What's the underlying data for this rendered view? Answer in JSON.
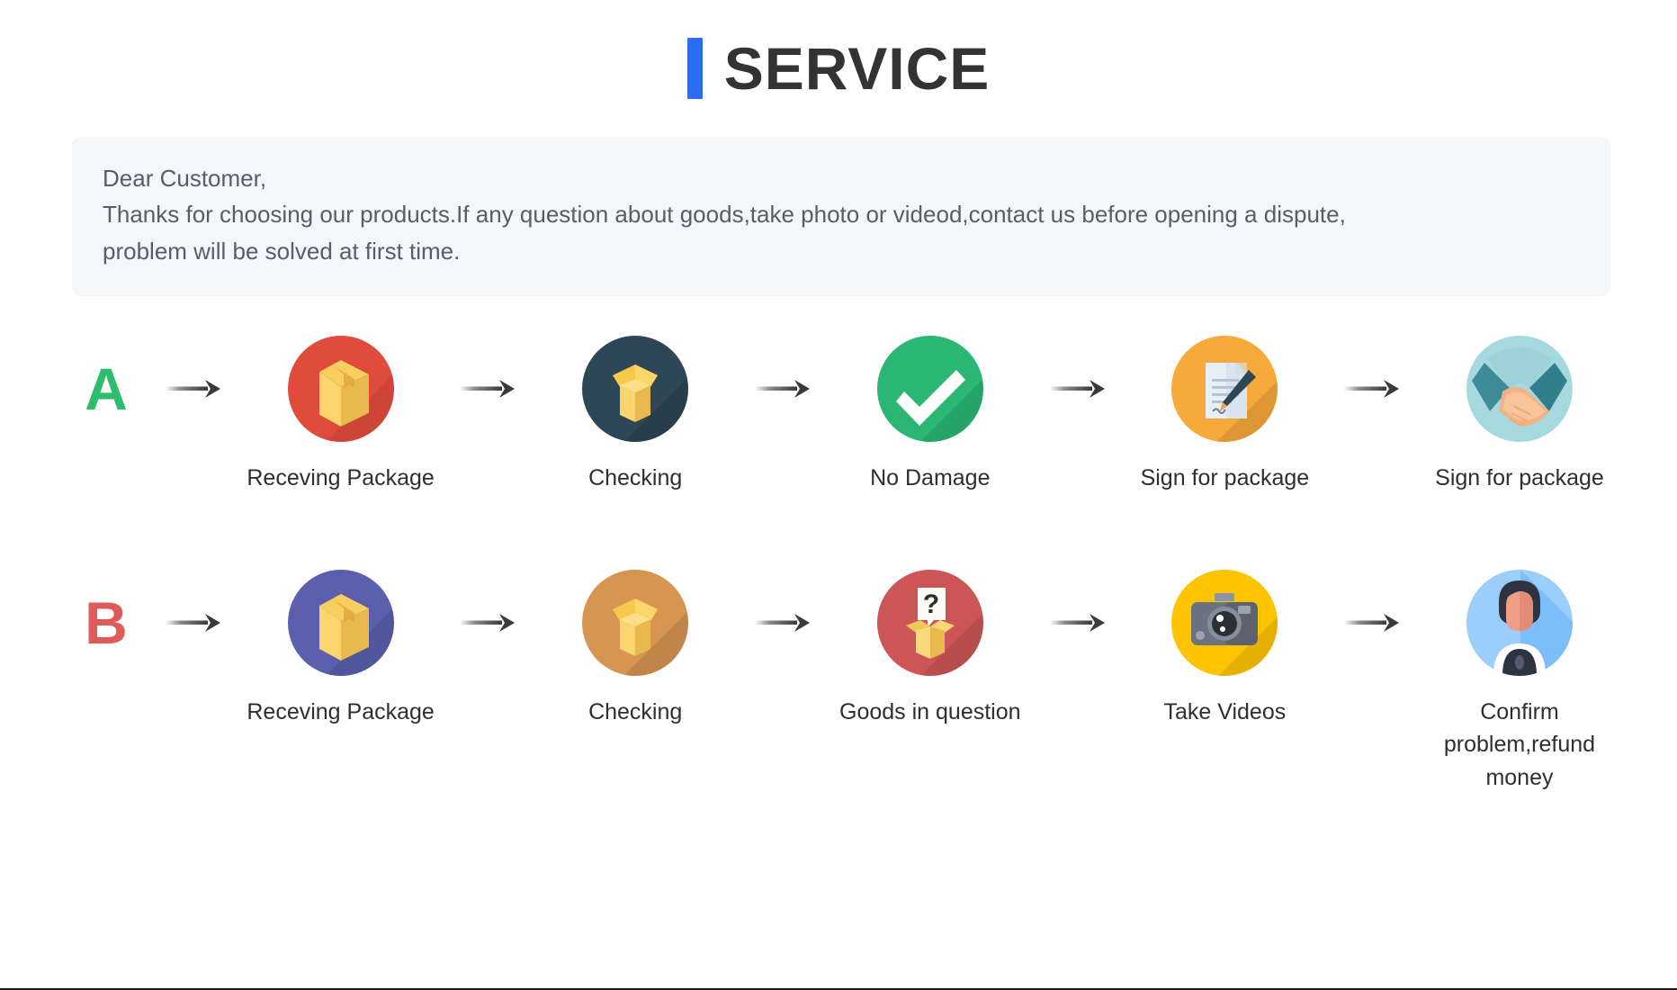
{
  "header": {
    "title": "SERVICE",
    "accent_color": "#2b6cf0"
  },
  "notice": {
    "line1": "Dear Customer,",
    "line2": "Thanks for choosing our products.If any question about goods,take photo or videod,contact us before opening a dispute,",
    "line3": "problem will be solved at first time.",
    "background_color": "#f4f6fa",
    "text_color": "#585e68"
  },
  "flows": [
    {
      "badge": "A",
      "badge_color": "#2ebd6e",
      "arrow": "arrow-right-icon",
      "steps": [
        {
          "label": "Receving Package",
          "icon": "package-box-icon",
          "circle_color": "#e04b3c"
        },
        {
          "label": "Checking",
          "icon": "open-box-icon",
          "circle_color": "#2e4756"
        },
        {
          "label": "No Damage",
          "icon": "check-mark-icon",
          "circle_color": "#2bb673"
        },
        {
          "label": "Sign for package",
          "icon": "document-pen-icon",
          "circle_color": "#f7a93b"
        },
        {
          "label": "Sign for package",
          "icon": "handshake-icon",
          "circle_color": "#a6d9de"
        }
      ]
    },
    {
      "badge": "B",
      "badge_color": "#e05a5a",
      "arrow": "arrow-right-icon",
      "steps": [
        {
          "label": "Receving Package",
          "icon": "package-box-icon",
          "circle_color": "#5b5fae"
        },
        {
          "label": "Checking",
          "icon": "open-box-icon",
          "circle_color": "#d79552"
        },
        {
          "label": "Goods in question",
          "icon": "question-box-icon",
          "circle_color": "#cc5656"
        },
        {
          "label": "Take Videos",
          "icon": "camera-icon",
          "circle_color": "#ffc400"
        },
        {
          "label": "Confirm problem,refund money",
          "icon": "support-person-icon",
          "circle_color": "#9ccefc"
        }
      ]
    }
  ]
}
